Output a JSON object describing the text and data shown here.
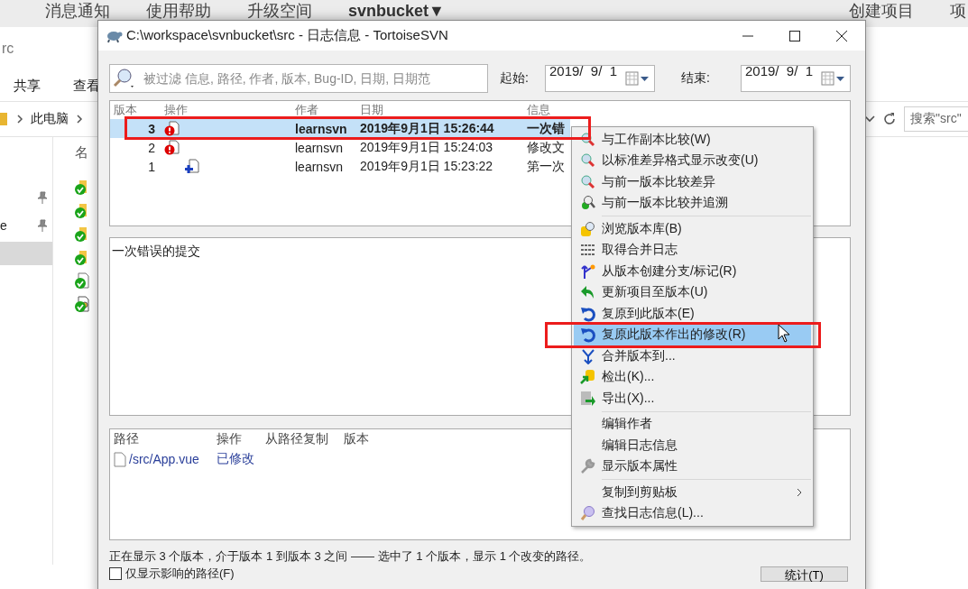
{
  "web_header": {
    "left": [
      "消息通知",
      "使用帮助",
      "升级空间"
    ],
    "project": "svnbucket▼",
    "right": [
      "创建项目",
      "项"
    ]
  },
  "explorer": {
    "title": "rc",
    "ribbon_tabs": [
      "共享",
      "查看"
    ],
    "breadcrumb": "此电脑",
    "search": {
      "placeholder": "搜索\"src\""
    },
    "nav_items": [
      {
        "pinned": true,
        "selected": false
      },
      {
        "label": "e",
        "pinned": true,
        "selected": false
      },
      {
        "pinned": false,
        "selected": true
      }
    ],
    "file_list": {
      "header": "名",
      "files": [
        {
          "kind": "folder"
        },
        {
          "kind": "folder"
        },
        {
          "kind": "folder"
        },
        {
          "kind": "folder"
        },
        {
          "kind": "file"
        },
        {
          "kind": "config"
        }
      ]
    }
  },
  "dialog": {
    "title": "C:\\workspace\\svnbucket\\src - 日志信息 - TortoiseSVN",
    "filter": {
      "placeholder": "被过滤 信息, 路径, 作者, 版本, Bug-ID, 日期, 日期范"
    },
    "start": {
      "label": "起始:",
      "value": "2019/  9/  1"
    },
    "end": {
      "label": "结束:",
      "value": "2019/  9/  1"
    },
    "log": {
      "columns": [
        "版本",
        "操作",
        "作者",
        "日期",
        "信息"
      ],
      "rows": [
        {
          "revision": "3",
          "kind": "modified",
          "author": "learnsvn",
          "date": "2019年9月1日 15:26:44",
          "message": "一次错",
          "selected": true,
          "annotated": true
        },
        {
          "revision": "2",
          "kind": "modified",
          "author": "learnsvn",
          "date": "2019年9月1日 15:24:03",
          "message": "修改文",
          "selected": false,
          "annotated": false
        },
        {
          "revision": "1",
          "kind": "added",
          "author": "learnsvn",
          "date": "2019年9月1日 15:23:22",
          "message": "第一次",
          "selected": false,
          "annotated": false
        }
      ]
    },
    "message": "一次错误的提交",
    "paths": {
      "columns": [
        "路径",
        "操作",
        "从路径复制",
        "版本"
      ],
      "rows": [
        {
          "path": "/src/App.vue",
          "action": "已修改"
        }
      ]
    },
    "status": "正在显示 3 个版本，介于版本 1 到版本 3 之间 —— 选中了 1 个版本，显示 1 个改变的路径。",
    "only_affected": {
      "label": "仅显示影响的路径(F)",
      "checked": false
    },
    "buttons": [
      "统计(T)"
    ]
  },
  "context_menu": {
    "groups": [
      [
        {
          "label": "与工作副本比较(W)",
          "kind": "compare",
          "selected": false,
          "annotated": false,
          "submenu": false
        },
        {
          "label": "以标准差异格式显示改变(U)",
          "kind": "compare",
          "selected": false,
          "annotated": false,
          "submenu": false
        },
        {
          "label": "与前一版本比较差异",
          "kind": "compare",
          "selected": false,
          "annotated": false,
          "submenu": false
        },
        {
          "label": "与前一版本比较并追溯",
          "kind": "blame",
          "selected": false,
          "annotated": false,
          "submenu": false
        }
      ],
      [
        {
          "label": "浏览版本库(B)",
          "kind": "repo",
          "selected": false,
          "annotated": false,
          "submenu": false
        },
        {
          "label": "取得合并日志",
          "kind": "lines",
          "selected": false,
          "annotated": false,
          "submenu": false
        },
        {
          "label": "从版本创建分支/标记(R)",
          "kind": "branch",
          "selected": false,
          "annotated": false,
          "submenu": false
        },
        {
          "label": "更新项目至版本(U)",
          "kind": "update",
          "selected": false,
          "annotated": false,
          "submenu": false
        },
        {
          "label": "复原到此版本(E)",
          "kind": "revert",
          "selected": false,
          "annotated": false,
          "submenu": false
        },
        {
          "label": "复原此版本作出的修改(R)",
          "kind": "revert",
          "selected": true,
          "annotated": true,
          "submenu": false
        },
        {
          "label": "合并版本到...",
          "kind": "merge",
          "selected": false,
          "annotated": false,
          "submenu": false
        },
        {
          "label": "检出(K)...",
          "kind": "checkout",
          "selected": false,
          "annotated": false,
          "submenu": false
        },
        {
          "label": "导出(X)...",
          "kind": "export",
          "selected": false,
          "annotated": false,
          "submenu": false
        }
      ],
      [
        {
          "label": "编辑作者",
          "kind": "plain",
          "selected": false,
          "annotated": false,
          "submenu": false
        },
        {
          "label": "编辑日志信息",
          "kind": "plain",
          "selected": false,
          "annotated": false,
          "submenu": false
        },
        {
          "label": "显示版本属性",
          "kind": "wrench",
          "selected": false,
          "annotated": false,
          "submenu": false
        }
      ],
      [
        {
          "label": "复制到剪贴板",
          "kind": "plain",
          "selected": false,
          "annotated": false,
          "submenu": true
        },
        {
          "label": "查找日志信息(L)...",
          "kind": "find",
          "selected": false,
          "annotated": false,
          "submenu": false
        }
      ]
    ]
  }
}
